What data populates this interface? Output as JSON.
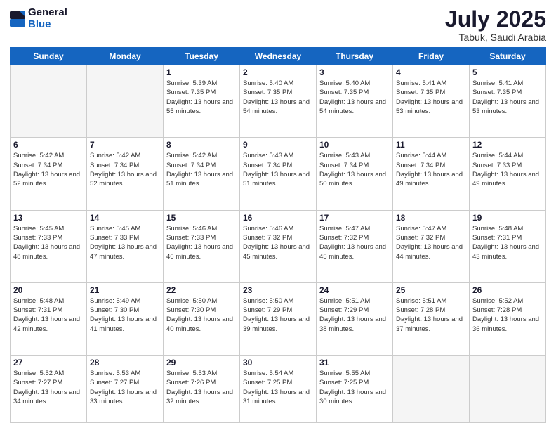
{
  "logo": {
    "general": "General",
    "blue": "Blue"
  },
  "header": {
    "month": "July 2025",
    "location": "Tabuk, Saudi Arabia"
  },
  "weekdays": [
    "Sunday",
    "Monday",
    "Tuesday",
    "Wednesday",
    "Thursday",
    "Friday",
    "Saturday"
  ],
  "weeks": [
    [
      {
        "day": "",
        "info": ""
      },
      {
        "day": "",
        "info": ""
      },
      {
        "day": "1",
        "info": "Sunrise: 5:39 AM\nSunset: 7:35 PM\nDaylight: 13 hours and 55 minutes."
      },
      {
        "day": "2",
        "info": "Sunrise: 5:40 AM\nSunset: 7:35 PM\nDaylight: 13 hours and 54 minutes."
      },
      {
        "day": "3",
        "info": "Sunrise: 5:40 AM\nSunset: 7:35 PM\nDaylight: 13 hours and 54 minutes."
      },
      {
        "day": "4",
        "info": "Sunrise: 5:41 AM\nSunset: 7:35 PM\nDaylight: 13 hours and 53 minutes."
      },
      {
        "day": "5",
        "info": "Sunrise: 5:41 AM\nSunset: 7:35 PM\nDaylight: 13 hours and 53 minutes."
      }
    ],
    [
      {
        "day": "6",
        "info": "Sunrise: 5:42 AM\nSunset: 7:34 PM\nDaylight: 13 hours and 52 minutes."
      },
      {
        "day": "7",
        "info": "Sunrise: 5:42 AM\nSunset: 7:34 PM\nDaylight: 13 hours and 52 minutes."
      },
      {
        "day": "8",
        "info": "Sunrise: 5:42 AM\nSunset: 7:34 PM\nDaylight: 13 hours and 51 minutes."
      },
      {
        "day": "9",
        "info": "Sunrise: 5:43 AM\nSunset: 7:34 PM\nDaylight: 13 hours and 51 minutes."
      },
      {
        "day": "10",
        "info": "Sunrise: 5:43 AM\nSunset: 7:34 PM\nDaylight: 13 hours and 50 minutes."
      },
      {
        "day": "11",
        "info": "Sunrise: 5:44 AM\nSunset: 7:34 PM\nDaylight: 13 hours and 49 minutes."
      },
      {
        "day": "12",
        "info": "Sunrise: 5:44 AM\nSunset: 7:33 PM\nDaylight: 13 hours and 49 minutes."
      }
    ],
    [
      {
        "day": "13",
        "info": "Sunrise: 5:45 AM\nSunset: 7:33 PM\nDaylight: 13 hours and 48 minutes."
      },
      {
        "day": "14",
        "info": "Sunrise: 5:45 AM\nSunset: 7:33 PM\nDaylight: 13 hours and 47 minutes."
      },
      {
        "day": "15",
        "info": "Sunrise: 5:46 AM\nSunset: 7:33 PM\nDaylight: 13 hours and 46 minutes."
      },
      {
        "day": "16",
        "info": "Sunrise: 5:46 AM\nSunset: 7:32 PM\nDaylight: 13 hours and 45 minutes."
      },
      {
        "day": "17",
        "info": "Sunrise: 5:47 AM\nSunset: 7:32 PM\nDaylight: 13 hours and 45 minutes."
      },
      {
        "day": "18",
        "info": "Sunrise: 5:47 AM\nSunset: 7:32 PM\nDaylight: 13 hours and 44 minutes."
      },
      {
        "day": "19",
        "info": "Sunrise: 5:48 AM\nSunset: 7:31 PM\nDaylight: 13 hours and 43 minutes."
      }
    ],
    [
      {
        "day": "20",
        "info": "Sunrise: 5:48 AM\nSunset: 7:31 PM\nDaylight: 13 hours and 42 minutes."
      },
      {
        "day": "21",
        "info": "Sunrise: 5:49 AM\nSunset: 7:30 PM\nDaylight: 13 hours and 41 minutes."
      },
      {
        "day": "22",
        "info": "Sunrise: 5:50 AM\nSunset: 7:30 PM\nDaylight: 13 hours and 40 minutes."
      },
      {
        "day": "23",
        "info": "Sunrise: 5:50 AM\nSunset: 7:29 PM\nDaylight: 13 hours and 39 minutes."
      },
      {
        "day": "24",
        "info": "Sunrise: 5:51 AM\nSunset: 7:29 PM\nDaylight: 13 hours and 38 minutes."
      },
      {
        "day": "25",
        "info": "Sunrise: 5:51 AM\nSunset: 7:28 PM\nDaylight: 13 hours and 37 minutes."
      },
      {
        "day": "26",
        "info": "Sunrise: 5:52 AM\nSunset: 7:28 PM\nDaylight: 13 hours and 36 minutes."
      }
    ],
    [
      {
        "day": "27",
        "info": "Sunrise: 5:52 AM\nSunset: 7:27 PM\nDaylight: 13 hours and 34 minutes."
      },
      {
        "day": "28",
        "info": "Sunrise: 5:53 AM\nSunset: 7:27 PM\nDaylight: 13 hours and 33 minutes."
      },
      {
        "day": "29",
        "info": "Sunrise: 5:53 AM\nSunset: 7:26 PM\nDaylight: 13 hours and 32 minutes."
      },
      {
        "day": "30",
        "info": "Sunrise: 5:54 AM\nSunset: 7:25 PM\nDaylight: 13 hours and 31 minutes."
      },
      {
        "day": "31",
        "info": "Sunrise: 5:55 AM\nSunset: 7:25 PM\nDaylight: 13 hours and 30 minutes."
      },
      {
        "day": "",
        "info": ""
      },
      {
        "day": "",
        "info": ""
      }
    ]
  ]
}
